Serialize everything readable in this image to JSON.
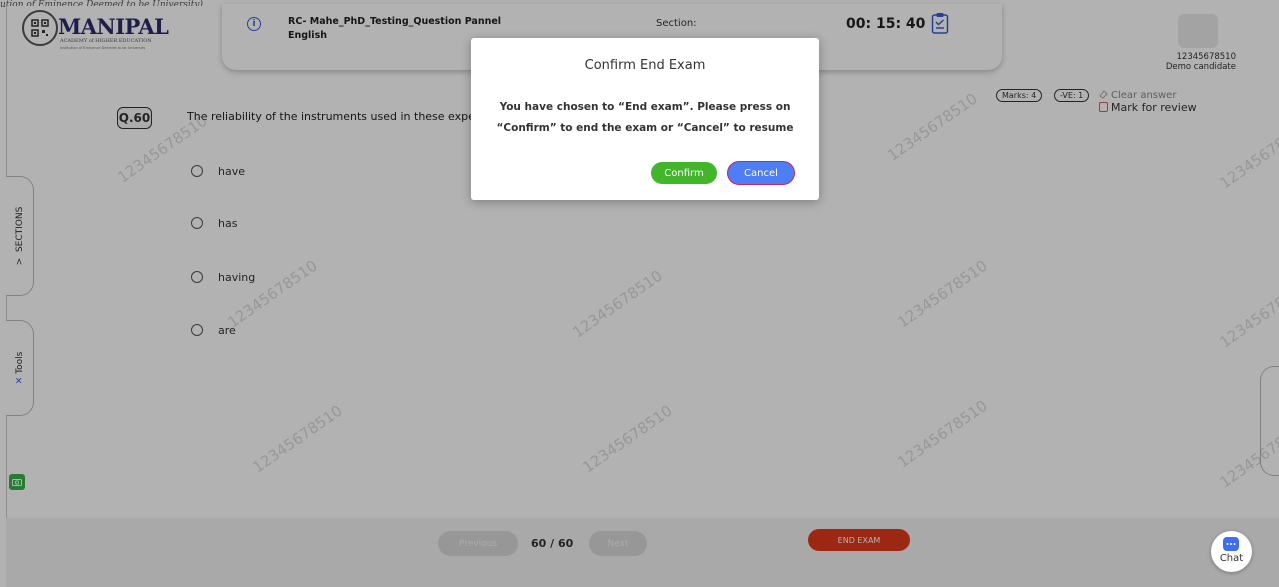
{
  "page": {
    "caption": "ution of Eminence Deemed to be University)"
  },
  "brand": {
    "logo_text": "MANIPAL",
    "logo_subtext": "ACADEMY of HIGHER EDUCATION",
    "logo_subtext2": "Institution of Eminence Deemed to be University",
    "qr_icon": "qr-code-icon"
  },
  "header": {
    "exam_title": "RC- Mahe_PhD_Testing_Question Pannel",
    "language": "English",
    "section_label": "Section:",
    "timer": "00: 15: 40",
    "info_icon": "info-icon",
    "clipboard_icon": "clipboard-check-icon"
  },
  "candidate": {
    "id": "12345678510",
    "name": "Demo candidate"
  },
  "question": {
    "number": "Q.60",
    "text": "The reliability of the instruments used in these experiment",
    "marks": "Marks: 4",
    "negative": "-VE: 1",
    "clear_answer": "Clear answer",
    "mark_for_review": "Mark for review",
    "options": [
      "have",
      "has",
      "having",
      "are"
    ]
  },
  "side_tabs": {
    "sections": "SECTIONS",
    "sections_arrow": ">",
    "tools": "Tools"
  },
  "footer": {
    "previous": "Previous",
    "page_count": "60 / 60",
    "next": "Next",
    "end_exam": "END EXAM",
    "chat": "Chat"
  },
  "watermark": {
    "text": "12345678510"
  },
  "modal": {
    "title": "Confirm End Exam",
    "line1": "You have chosen to “End exam”. Please press on",
    "line2": "“Confirm” to end the exam or “Cancel” to resume",
    "confirm": "Confirm",
    "cancel": "Cancel"
  },
  "colors": {
    "confirm": "#43b52b",
    "cancel": "#4f7df5",
    "end_exam": "#e03a1e",
    "accent": "#3b5bd6",
    "chat": "#3f6ef0"
  }
}
